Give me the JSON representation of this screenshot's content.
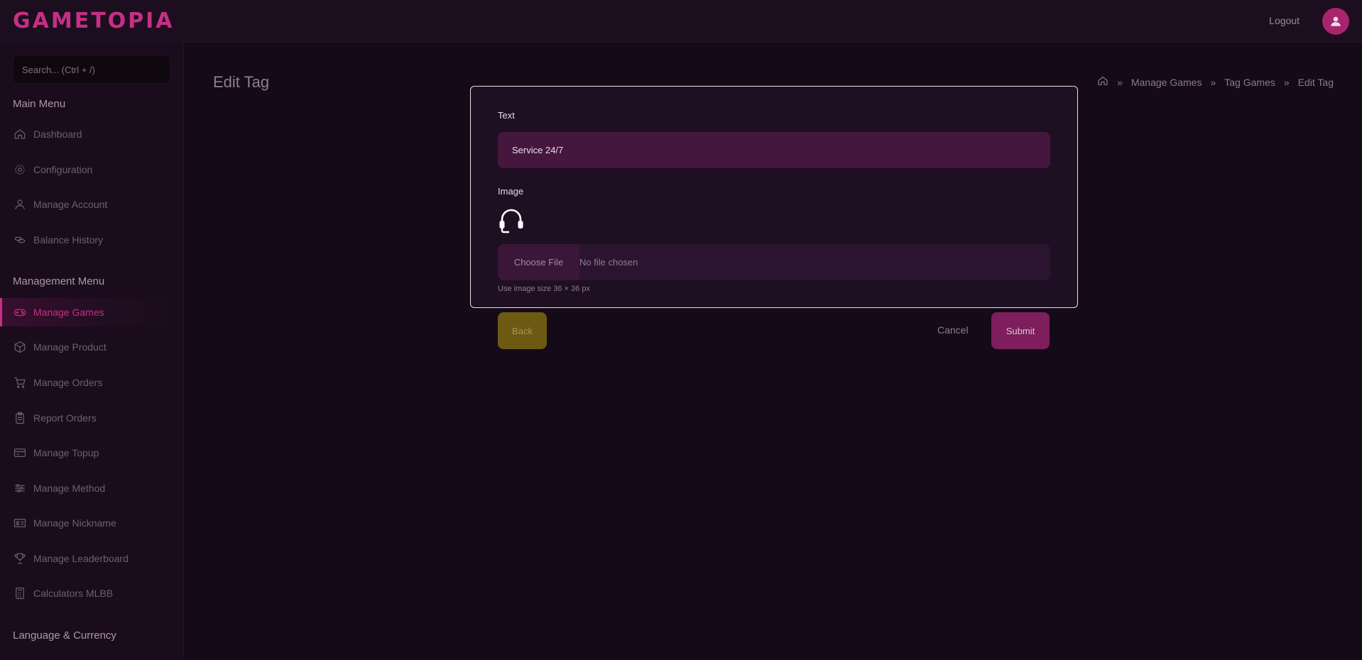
{
  "app": {
    "logo": "GAMETOPIA"
  },
  "header": {
    "logout_label": "Logout",
    "avatar_icon": "user-icon"
  },
  "sidebar": {
    "search_placeholder": "Search... (Ctrl + /)",
    "main_menu_title": "Main Menu",
    "main_items": [
      {
        "label": "Dashboard",
        "icon": "home-icon"
      },
      {
        "label": "Configuration",
        "icon": "gear-icon"
      },
      {
        "label": "Manage Account",
        "icon": "user-icon"
      },
      {
        "label": "Balance History",
        "icon": "coins-icon"
      }
    ],
    "management_menu_title": "Management Menu",
    "management_items": [
      {
        "label": "Manage Games",
        "icon": "gamepad-icon",
        "active": true
      },
      {
        "label": "Manage Product",
        "icon": "box-icon"
      },
      {
        "label": "Manage Orders",
        "icon": "cart-icon"
      },
      {
        "label": "Report Orders",
        "icon": "clipboard-icon"
      },
      {
        "label": "Manage Topup",
        "icon": "wallet-icon"
      },
      {
        "label": "Manage Method",
        "icon": "sliders-icon"
      },
      {
        "label": "Manage Nickname",
        "icon": "id-card-icon"
      },
      {
        "label": "Manage Leaderboard",
        "icon": "trophy-icon"
      },
      {
        "label": "Calculators MLBB",
        "icon": "calculator-icon"
      }
    ],
    "language_title": "Language & Currency"
  },
  "page": {
    "title": "Edit Tag",
    "breadcrumb": [
      "Manage Games",
      "Tag Games",
      "Edit Tag"
    ]
  },
  "form": {
    "text_label": "Text",
    "text_value": "Service 24/7",
    "image_label": "Image",
    "image_icon": "headset-icon",
    "choose_file_label": "Choose File",
    "file_status": "No file chosen",
    "hint": "Use image size 36 × 36 px",
    "back_label": "Back",
    "cancel_label": "Cancel",
    "submit_label": "Submit"
  },
  "colors": {
    "accent": "#c62f86",
    "background": "#150a17",
    "back_button": "#6c5a13",
    "submit_button": "#7e1e5c"
  }
}
